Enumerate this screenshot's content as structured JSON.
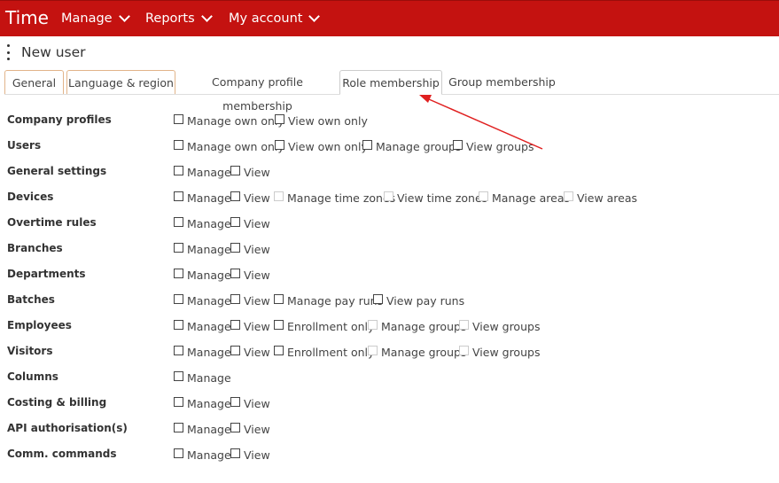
{
  "topbar": {
    "brand": "Time",
    "menus": [
      "Manage",
      "Reports",
      "My account"
    ]
  },
  "page": {
    "title": "New user"
  },
  "tabs": [
    "General",
    "Language & region",
    "Company profile membership",
    "Role membership",
    "Group membership"
  ],
  "rows": [
    {
      "label": "Company profiles",
      "options": [
        "Manage own only",
        "View own only"
      ]
    },
    {
      "label": "Users",
      "options": [
        "Manage own only",
        "View own only",
        "Manage groups",
        "View groups"
      ]
    },
    {
      "label": "General settings",
      "options": [
        "Manage",
        "View"
      ]
    },
    {
      "label": "Devices",
      "options": [
        "Manage",
        "View",
        "Manage time zones",
        "View time zones",
        "Manage areas",
        "View areas"
      ]
    },
    {
      "label": "Overtime rules",
      "options": [
        "Manage",
        "View"
      ]
    },
    {
      "label": "Branches",
      "options": [
        "Manage",
        "View"
      ]
    },
    {
      "label": "Departments",
      "options": [
        "Manage",
        "View"
      ]
    },
    {
      "label": "Batches",
      "options": [
        "Manage",
        "View",
        "Manage pay runs",
        "View pay runs"
      ]
    },
    {
      "label": "Employees",
      "options": [
        "Manage",
        "View",
        "Enrollment only",
        "Manage groups",
        "View groups"
      ]
    },
    {
      "label": "Visitors",
      "options": [
        "Manage",
        "View",
        "Enrollment only",
        "Manage groups",
        "View groups"
      ]
    },
    {
      "label": "Columns",
      "options": [
        "Manage"
      ]
    },
    {
      "label": "Costing & billing",
      "options": [
        "Manage",
        "View"
      ]
    },
    {
      "label": "API authorisation(s)",
      "options": [
        "Manage",
        "View"
      ]
    },
    {
      "label": "Comm. commands",
      "options": [
        "Manage",
        "View"
      ]
    }
  ],
  "colors": {
    "topbar": "#c41210",
    "annotation_arrow": "#e02020"
  }
}
